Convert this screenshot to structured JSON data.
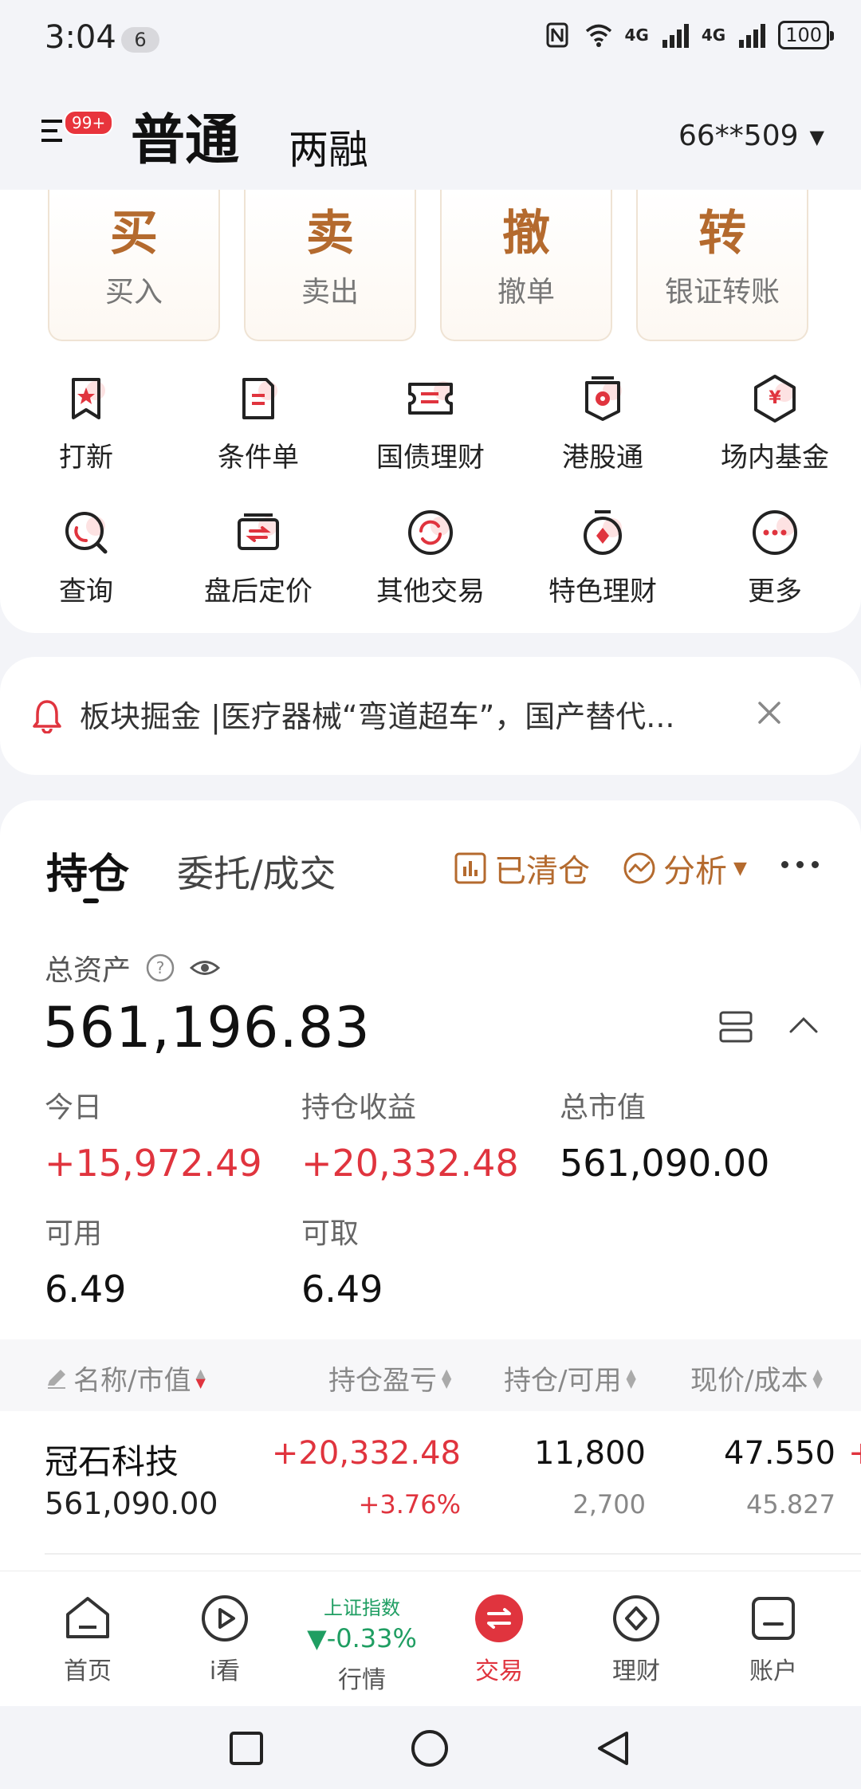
{
  "status": {
    "time": "3:04",
    "notif_count": "6",
    "net1": "4G",
    "net2": "4G",
    "battery": "100"
  },
  "header": {
    "menu_badge": "99+",
    "tab_normal": "普通",
    "tab_margin": "两融",
    "account": "66**509"
  },
  "quick_actions": [
    {
      "char": "买",
      "label": "买入"
    },
    {
      "char": "卖",
      "label": "卖出"
    },
    {
      "char": "撤",
      "label": "撤单"
    },
    {
      "char": "转",
      "label": "银证转账"
    }
  ],
  "grid": [
    {
      "label": "打新",
      "icon": "bookmark-star-icon"
    },
    {
      "label": "条件单",
      "icon": "document-icon"
    },
    {
      "label": "国债理财",
      "icon": "ticket-icon"
    },
    {
      "label": "港股通",
      "icon": "hk-flower-icon"
    },
    {
      "label": "场内基金",
      "icon": "yen-hexagon-icon"
    },
    {
      "label": "查询",
      "icon": "search-icon"
    },
    {
      "label": "盘后定价",
      "icon": "exchange-card-icon"
    },
    {
      "label": "其他交易",
      "icon": "refresh-circle-icon"
    },
    {
      "label": "特色理财",
      "icon": "stopwatch-icon"
    },
    {
      "label": "更多",
      "icon": "more-dots-icon"
    }
  ],
  "notice": {
    "text": "板块掘金 |医疗器械“弯道超车”，国产替代..."
  },
  "holdings": {
    "tab_hold": "持仓",
    "tab_order": "委托/成交",
    "cleared_label": "已清仓",
    "analysis_label": "分析",
    "total_assets_label": "总资产",
    "total_assets_value": "561,196.83",
    "stats": [
      {
        "label": "今日",
        "value": "+15,972.49",
        "red": true
      },
      {
        "label": "持仓收益",
        "value": "+20,332.48",
        "red": true
      },
      {
        "label": "总市值",
        "value": "561,090.00",
        "red": false
      },
      {
        "label": "可用",
        "value": "6.49",
        "red": false
      },
      {
        "label": "可取",
        "value": "6.49",
        "red": false
      }
    ],
    "columns": {
      "name": "名称/市值",
      "pnl": "持仓盈亏",
      "qty": "持仓/可用",
      "price": "现价/成本"
    },
    "rows": [
      {
        "name": "冠石科技",
        "market_value": "561,090.00",
        "pnl": "+20,332.48",
        "pnl_pct": "+3.76%",
        "qty": "11,800",
        "available": "2,700",
        "price": "47.550",
        "cost": "45.827",
        "overflow": "+"
      }
    ]
  },
  "bottom_nav": {
    "home": "首页",
    "watch": "i看",
    "index_name": "上证指数",
    "index_value": "▼-0.33%",
    "market": "行情",
    "trade": "交易",
    "wealth": "理财",
    "account": "账户"
  },
  "colors": {
    "accent_red": "#e0343e",
    "accent_brown": "#b46a2e",
    "down_green": "#1f9e62"
  }
}
